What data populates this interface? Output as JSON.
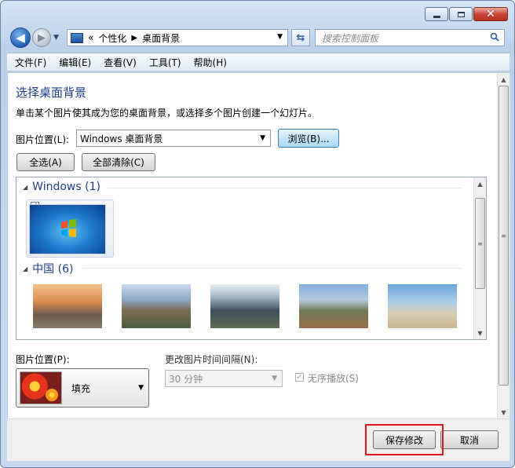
{
  "window": {
    "breadcrumb": [
      "个性化",
      "桌面背景"
    ],
    "breadcrumb_prefix": "«",
    "search_placeholder": "搜索控制面板"
  },
  "menu": [
    "文件(F)",
    "编辑(E)",
    "查看(V)",
    "工具(T)",
    "帮助(H)"
  ],
  "page": {
    "title": "选择桌面背景",
    "description": "单击某个图片使其成为您的桌面背景，或选择多个图片创建一个幻灯片。",
    "location_label": "图片位置(L):",
    "location_value": "Windows 桌面背景",
    "browse_label": "浏览(B)...",
    "select_all_label": "全选(A)",
    "clear_all_label": "全部清除(C)"
  },
  "groups": [
    {
      "label": "Windows (1)"
    },
    {
      "label": "中国 (6)"
    }
  ],
  "position": {
    "label": "图片位置(P):",
    "value": "填充"
  },
  "interval": {
    "label": "更改图片时间间隔(N):",
    "value": "30 分钟"
  },
  "shuffle": {
    "label": "无序播放(S)",
    "checked": true
  },
  "footer": {
    "save_label": "保存修改",
    "cancel_label": "取消"
  },
  "colors": {
    "title": "#1e3c8c",
    "highlight_box": "#e0141b"
  }
}
